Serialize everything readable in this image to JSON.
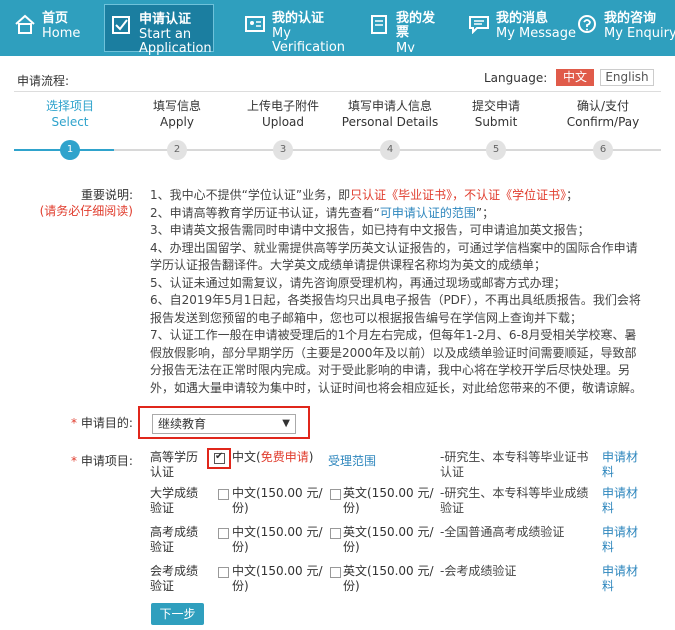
{
  "nav": {
    "items": [
      {
        "zh": "首页",
        "en": "Home",
        "icon": "home-icon"
      },
      {
        "zh": "申请认证",
        "en": "Start an Application",
        "icon": "checkbox-icon"
      },
      {
        "zh": "我的认证",
        "en": "My Verification",
        "icon": "id-card-icon"
      },
      {
        "zh": "我的发票",
        "en": "My",
        "icon": "invoice-icon"
      },
      {
        "zh": "我的消息",
        "en": "My Message",
        "icon": "message-icon"
      },
      {
        "zh": "我的咨询",
        "en": "My Enquiry",
        "icon": "enquiry-icon"
      }
    ]
  },
  "header": {
    "flow_label": "申请流程:",
    "language_label": "Language:",
    "lang_zh": "中文",
    "lang_en": "English"
  },
  "steps": [
    {
      "zh": "选择项目",
      "en": "Select",
      "num": "1"
    },
    {
      "zh": "填写信息",
      "en": "Apply",
      "num": "2"
    },
    {
      "zh": "上传电子附件",
      "en": "Upload",
      "num": "3"
    },
    {
      "zh": "填写申请人信息",
      "en": "Personal Details",
      "num": "4"
    },
    {
      "zh": "提交申请",
      "en": "Submit",
      "num": "5"
    },
    {
      "zh": "确认/支付",
      "en": "Confirm/Pay",
      "num": "6"
    }
  ],
  "notes": {
    "label": "重要说明:",
    "sub_label": "(请务必仔细阅读)",
    "n1_a": "1、我中心不提供“学位认证”业务，即",
    "n1_b": "只认证《毕业证书》，不认证《学位证书》",
    "n1_c": "；",
    "n2_a": "2、申请高等教育学历证书认证，请先查看“",
    "n2_b": "可申请认证的范围",
    "n2_c": "”；",
    "n3": "3、申请英文报告需同时申请中文报告，如已持有中文报告，可申请追加英文报告；",
    "n4": "4、办理出国留学、就业需提供高等学历英文认证报告的，可通过学信档案中的国际合作申请学历认证报告翻译件。大学英文成绩单请提供课程名称均为英文的成绩单；",
    "n5": "5、认证未通过如需复议，请先咨询原受理机构，再通过现场或邮寄方式办理；",
    "n6": "6、自2019年5月1日起，各类报告均只出具电子报告（PDF），不再出具纸质报告。我们会将报告发送到您预留的电子邮箱中，您也可以根据报告编号在学信网上查询并下载；",
    "n7": "7、认证工作一般在申请被受理后的1个月左右完成，但每年1-2月、6-8月受相关学校寒、暑假放假影响，部分早期学历（主要是2000年及以前）以及成绩单验证时间需要顺延，导致部分报告无法在正常时限内完成。对于受此影响的申请，我中心将在学校开学后尽快处理。另外，如遇大量申请较为集中时，认证时间也将会相应延长，对此给您带来的不便，敬请谅解。"
  },
  "purpose": {
    "star": "*",
    "label": "申请目的:",
    "value": "继续教育"
  },
  "items_section": {
    "star": "*",
    "label": "申请项目:",
    "scope_link": "受理范围",
    "rows": [
      {
        "name": "高等学历认证",
        "opt1": "中文(",
        "opt1_free": "免费申请",
        "opt1_end": ")",
        "opt2": "",
        "desc": "-研究生、本专科等毕业证书认证",
        "mat": "申请材料"
      },
      {
        "name": "大学成绩验证",
        "opt1": "中文(150.00 元/份)",
        "opt2": "英文(150.00 元/份)",
        "desc": "-研究生、本专科等毕业成绩验证",
        "mat": "申请材料"
      },
      {
        "name": "高考成绩验证",
        "opt1": "中文(150.00 元/份)",
        "opt2": "英文(150.00 元/份)",
        "desc": "-全国普通高考成绩验证",
        "mat": "申请材料"
      },
      {
        "name": "会考成绩验证",
        "opt1": "中文(150.00 元/份)",
        "opt2": "英文(150.00 元/份)",
        "desc": "-会考成绩验证",
        "mat": "申请材料"
      }
    ]
  },
  "next_button": "下一步",
  "colors": {
    "nav_bg": "#2f9fbe",
    "nav_active": "#1b7ea0",
    "accent_blue": "#2fa3cc",
    "red": "#e03c2d",
    "link_blue": "#2d86bd"
  }
}
